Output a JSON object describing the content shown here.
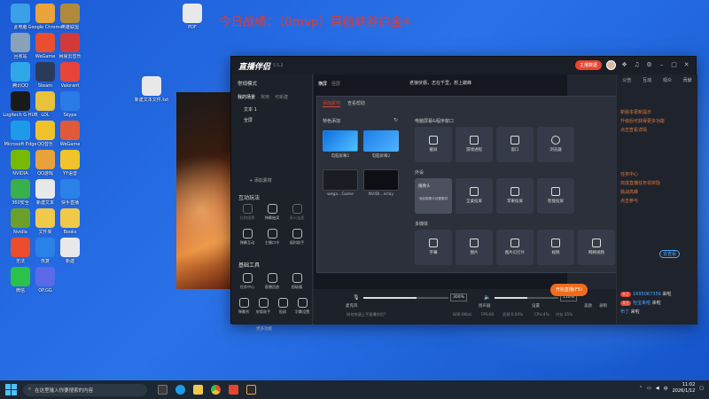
{
  "headline": "今日战绩：（0mvp）目前峡谷白金4",
  "desktop_icons": [
    {
      "label": "此电脑",
      "color": "#3aa0e8"
    },
    {
      "label": "Google Chrome",
      "color": "#e8a33a"
    },
    {
      "label": "英雄联盟",
      "color": "#b08a3a"
    },
    {
      "label": "回收站",
      "color": "#8aa2b8"
    },
    {
      "label": "WeGame",
      "color": "#e84e2f"
    },
    {
      "label": "网易云音乐",
      "color": "#d23a3a"
    },
    {
      "label": "腾讯QQ",
      "color": "#2fa8e8"
    },
    {
      "label": "Steam",
      "color": "#2a3b5a"
    },
    {
      "label": "Valorant",
      "color": "#e8443a"
    },
    {
      "label": "Logitech G HUB",
      "color": "#1a1a1a"
    },
    {
      "label": "LOL",
      "color": "#e8c23a"
    },
    {
      "label": "Skype",
      "color": "#2a7ae8"
    },
    {
      "label": "Microsoft Edge",
      "color": "#1e9be8"
    },
    {
      "label": "QQ音乐",
      "color": "#f0c22a"
    },
    {
      "label": "WeGame",
      "color": "#e05a3a"
    },
    {
      "label": "NVIDIA",
      "color": "#76b900"
    },
    {
      "label": "QQ游戏",
      "color": "#e8a23a"
    },
    {
      "label": "YY语音",
      "color": "#f0c42a"
    },
    {
      "label": "360安全",
      "color": "#3ab04a"
    },
    {
      "label": "新建文本",
      "color": "#e8e8e8"
    },
    {
      "label": "快手直播",
      "color": "#2a82e8"
    },
    {
      "label": "Nvidia",
      "color": "#6aa02a"
    },
    {
      "label": "文件夹",
      "color": "#f0c84a"
    },
    {
      "label": "Books",
      "color": "#f0c84a"
    },
    {
      "label": "无法",
      "color": "#e84e2f"
    },
    {
      "label": "恢复",
      "color": "#2a82e8"
    },
    {
      "label": "新建",
      "color": "#e8e8e8"
    },
    {
      "label": "微信",
      "color": "#2bc24a"
    },
    {
      "label": "OP.GG",
      "color": "#5a6ae8"
    },
    {
      "label": "PDF",
      "color": "#e8e8e8"
    },
    {
      "label": "新建文本文件.txt",
      "color": "#e8e8e8"
    }
  ],
  "app": {
    "name": "直播伴侣",
    "version": "5.5.2",
    "live_badge": "主播数据",
    "left": {
      "mode": "常规模式",
      "tabs": [
        "我的场景",
        "常用",
        "可新建"
      ],
      "scenes": [
        "文本 1",
        "全屏"
      ],
      "add_source": "+ 添加素材",
      "interact_title": "互动玩法",
      "interact": [
        "礼物投票",
        "弹幕抽奖",
        "多人连麦",
        "弹幕互动",
        "主播口令",
        "福利助手"
      ],
      "tools_title": "基础工具",
      "tools": [
        "任务中心",
        "直播回放",
        "超级看"
      ],
      "tools2": [
        "弹幕秀",
        "房管助手",
        "投屏",
        "字幕设置"
      ],
      "more": "更多功能"
    },
    "preview_tabs": [
      "横屏",
      "竖屏"
    ],
    "streamer_text": "老狼伏枥，志在千里，想上巅峰"
  },
  "dialog": {
    "tabs": [
      "添加素材",
      "查看帮助"
    ],
    "feature_title": "特色添加",
    "screen_title": "电脑屏幕&程序窗口",
    "thumbs": [
      "电脑屏幕1",
      "电脑屏幕2",
      "wega...Game",
      "NVIDI...erlay"
    ],
    "screen_sources": [
      "截屏",
      "游戏进程",
      "窗口",
      "浏览器"
    ],
    "external_title": "外设",
    "external_sources": [
      "摄像头",
      "全桌投屏",
      "苹果投屏",
      "智能投屏"
    ],
    "camera_tip": "添加摄像头设置素材",
    "media_title": "多媒体",
    "media_sources": [
      "字幕",
      "图片",
      "图片幻灯片",
      "视频",
      "网络视频"
    ]
  },
  "controls": {
    "mic_label": "麦克风",
    "mic_pct": "300%",
    "speaker_label": "扬声器",
    "speaker_pct": "110%",
    "mic_level": 0.62,
    "speaker_level": 0.52,
    "buttons": [
      "美颜",
      "录制",
      "设置"
    ],
    "start_button": "开始直播(F5)",
    "status": [
      "如何快速上手直播伴侣?",
      "码率:0Kb/s",
      "FPS:60",
      "丢帧:0.00%",
      "CPU:4%",
      "内存:35%"
    ]
  },
  "right": {
    "tabs": [
      "公告",
      "互动",
      "观众",
      "贡献"
    ],
    "lines": [
      "新版本更新提示",
      "升级后可获得更多功能",
      "点击查看详情",
      "任务中心",
      "完成直播任务领奖励",
      "挑战高峰",
      "点击参与"
    ],
    "link": "去查看",
    "chat": [
      {
        "tag": "关注",
        "name": "1695067356",
        "text": "来啦"
      },
      {
        "tag": "关注",
        "name": "怡宝来啦",
        "text": "来啦"
      },
      {
        "tag": "",
        "name": "布丁",
        "text": "来啦"
      }
    ]
  },
  "taskbar": {
    "search_placeholder": "在这里输入你要搜索的内容",
    "time": "11:02",
    "date": "2026/1/12",
    "ime": "中"
  }
}
